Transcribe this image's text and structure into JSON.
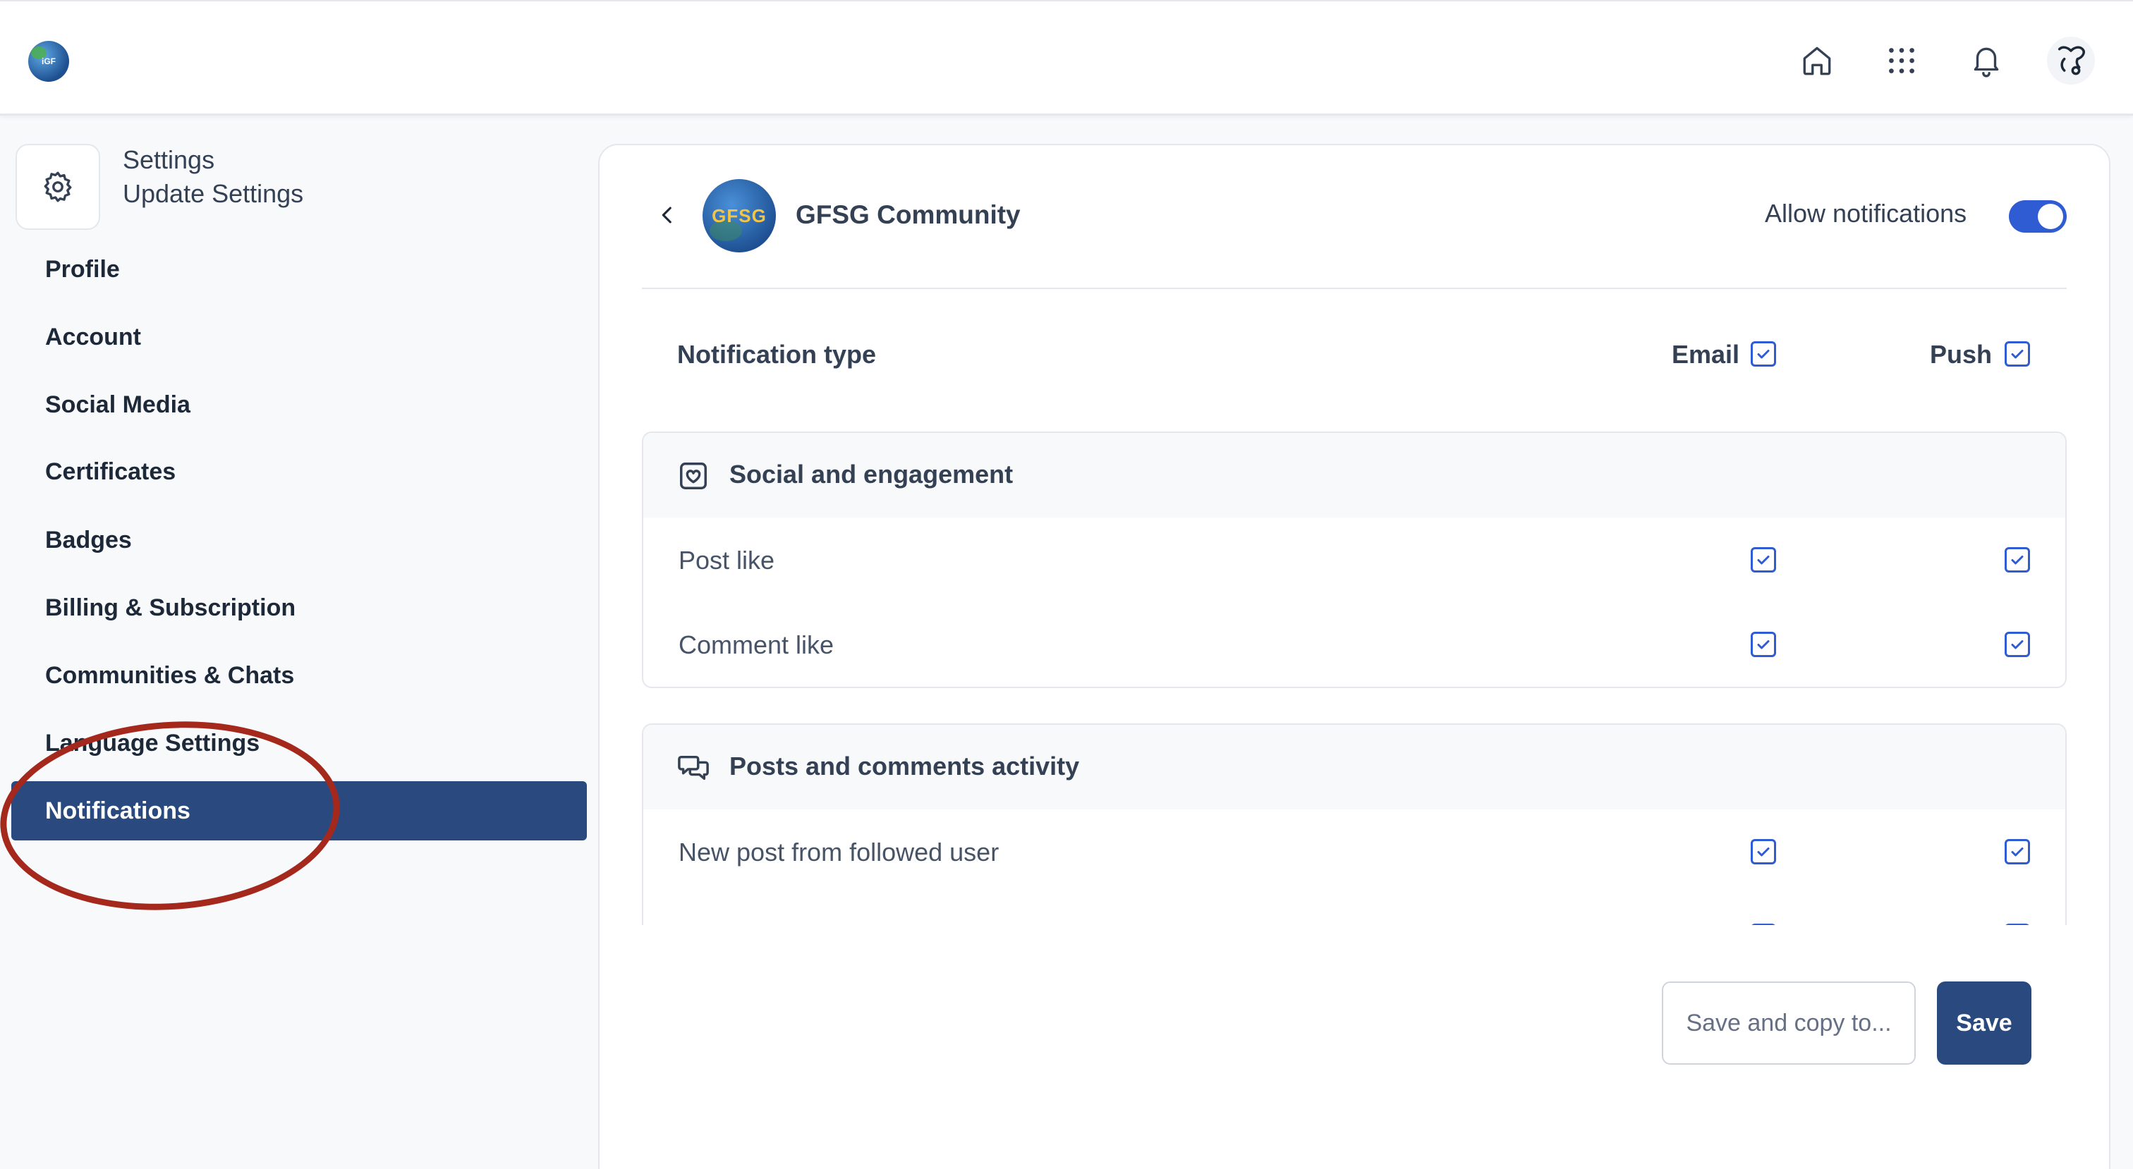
{
  "header": {
    "logo_text": "iGF",
    "icons": [
      "home-icon",
      "apps-grid-icon",
      "bell-icon",
      "user-avatar"
    ]
  },
  "sidebar": {
    "title": "Settings",
    "subtitle": "Update Settings",
    "items": [
      {
        "label": "Profile"
      },
      {
        "label": "Account"
      },
      {
        "label": "Social Media"
      },
      {
        "label": "Certificates"
      },
      {
        "label": "Badges"
      },
      {
        "label": "Billing & Subscription"
      },
      {
        "label": "Communities & Chats"
      },
      {
        "label": "Language Settings"
      },
      {
        "label": "Notifications",
        "active": true
      }
    ]
  },
  "community": {
    "logo_text": "GFSG",
    "name": "GFSG Community",
    "allow_label": "Allow notifications",
    "allow_enabled": true
  },
  "table_header": {
    "type": "Notification type",
    "email": "Email",
    "push": "Push",
    "email_checked": true,
    "push_checked": true
  },
  "groups": [
    {
      "title": "Social and engagement",
      "icon": "heart-box-icon",
      "rows": [
        {
          "label": "Post like",
          "email": true,
          "push": true
        },
        {
          "label": "Comment like",
          "email": true,
          "push": true
        }
      ]
    },
    {
      "title": "Posts and comments activity",
      "icon": "chat-bubbles-icon",
      "rows": [
        {
          "label": "New post from followed user",
          "email": true,
          "push": true
        }
      ]
    }
  ],
  "actions": {
    "secondary": "Save and copy to...",
    "primary": "Save"
  },
  "colors": {
    "accent": "#2f5bd3",
    "nav_active": "#2a4a7f",
    "annotation": "#a5281c"
  }
}
